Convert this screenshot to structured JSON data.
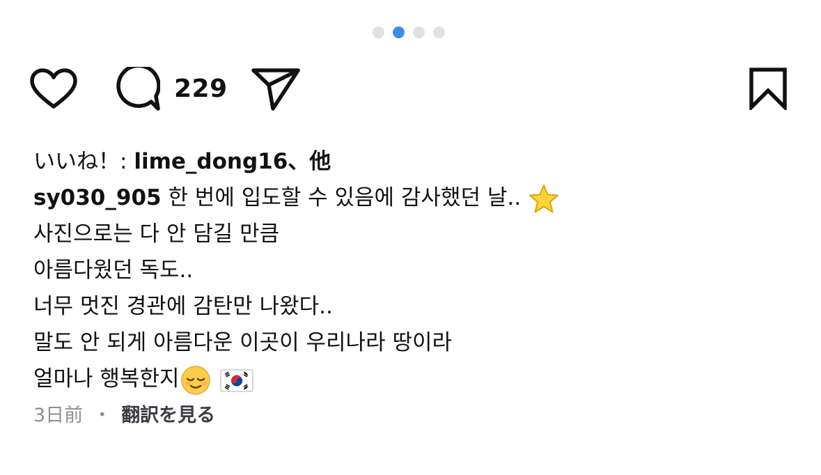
{
  "carousel": {
    "page_count": 4,
    "active_index": 1,
    "active_color": "#3a8ee8",
    "inactive_color": "#dfe1e5"
  },
  "actions": {
    "like_icon": "heart-outline-icon",
    "comment_icon": "comment-bubble-icon",
    "comment_count": "229",
    "share_icon": "paper-plane-icon",
    "save_icon": "bookmark-outline-icon"
  },
  "likes": {
    "prefix": "いいね！: ",
    "user": "lime_dong16",
    "suffix": "、他"
  },
  "caption": {
    "author": "sy030_905",
    "lines": [
      "한 번에 입도할 수 있음에 감사했던 날..",
      "사진으로는 다 안 담길 만큼",
      "아름다웠던 독도..",
      "너무 멋진 경관에 감탄만 나왔다..",
      "말도 안 되게 아름다운 이곳이 우리나라 땅이라",
      "얼마나 행복한지"
    ],
    "emojis": [
      "star-emoji",
      "relieved-face-emoji",
      "south-korea-flag-emoji"
    ]
  },
  "meta": {
    "time": "3日前",
    "separator": "・",
    "translate": "翻訳を見る"
  }
}
